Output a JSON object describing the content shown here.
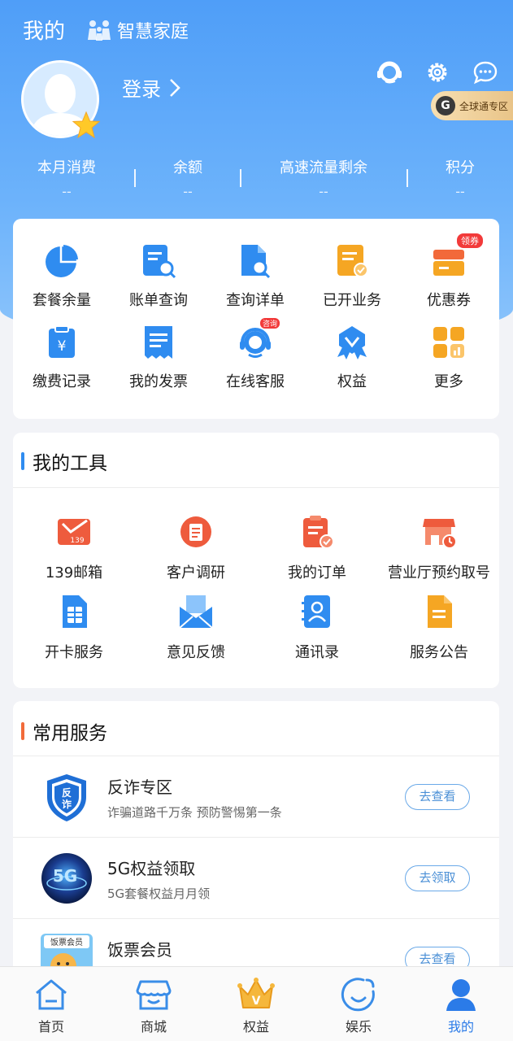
{
  "header": {
    "title": "我的",
    "family_label": "智慧家庭",
    "login_label": "登录",
    "global_zone_label": "全球通专区",
    "global_zone_badge": "G"
  },
  "stats": [
    {
      "label": "本月消费",
      "value": "--"
    },
    {
      "label": "余额",
      "value": "--"
    },
    {
      "label": "高速流量剩余",
      "value": "--"
    },
    {
      "label": "积分",
      "value": "--"
    }
  ],
  "quick_grid": [
    {
      "label": "套餐余量",
      "icon": "pie-chart-icon"
    },
    {
      "label": "账单查询",
      "icon": "bill-search-icon"
    },
    {
      "label": "查询详单",
      "icon": "detail-search-icon"
    },
    {
      "label": "已开业务",
      "icon": "opened-service-icon"
    },
    {
      "label": "优惠券",
      "icon": "coupon-icon",
      "badge": "领券"
    },
    {
      "label": "缴费记录",
      "icon": "payment-record-icon"
    },
    {
      "label": "我的发票",
      "icon": "invoice-icon"
    },
    {
      "label": "在线客服",
      "icon": "customer-service-icon",
      "badge": "咨询"
    },
    {
      "label": "权益",
      "icon": "rights-icon"
    },
    {
      "label": "更多",
      "icon": "more-grid-icon"
    }
  ],
  "tools": {
    "title": "我的工具",
    "items": [
      {
        "label": "139邮箱",
        "icon": "mail-139-icon",
        "icon_text": "139"
      },
      {
        "label": "客户调研",
        "icon": "survey-icon"
      },
      {
        "label": "我的订单",
        "icon": "order-icon"
      },
      {
        "label": "营业厅预约取号",
        "icon": "store-queue-icon"
      },
      {
        "label": "开卡服务",
        "icon": "sim-card-icon"
      },
      {
        "label": "意见反馈",
        "icon": "feedback-icon"
      },
      {
        "label": "通讯录",
        "icon": "contacts-icon"
      },
      {
        "label": "服务公告",
        "icon": "notice-icon"
      }
    ]
  },
  "services": {
    "title": "常用服务",
    "items": [
      {
        "title": "反诈专区",
        "subtitle": "诈骗道路千万条 预防警惕第一条",
        "button": "去查看",
        "icon": "anti-fraud-shield-icon",
        "icon_text": "反诈"
      },
      {
        "title": "5G权益领取",
        "subtitle": "5G套餐权益月月领",
        "button": "去领取",
        "icon": "5g-globe-icon",
        "icon_text": "5G"
      },
      {
        "title": "饭票会员",
        "subtitle": "",
        "button": "去查看",
        "icon": "meal-ticket-icon",
        "icon_text": "饭票会员"
      }
    ]
  },
  "tabbar": [
    {
      "label": "首页",
      "icon": "home-icon"
    },
    {
      "label": "商城",
      "icon": "shop-icon"
    },
    {
      "label": "权益",
      "icon": "crown-icon"
    },
    {
      "label": "娱乐",
      "icon": "entertainment-icon"
    },
    {
      "label": "我的",
      "icon": "profile-icon",
      "active": true
    }
  ],
  "colors": {
    "hero_blue": "#4f9ef8",
    "accent_blue": "#2b7be8",
    "tools_bar": "#2f8cf0",
    "services_bar": "#f26b3a",
    "icon_blue": "#2f8cf0",
    "icon_orange": "#f5a623",
    "icon_red": "#ee5b3d"
  }
}
